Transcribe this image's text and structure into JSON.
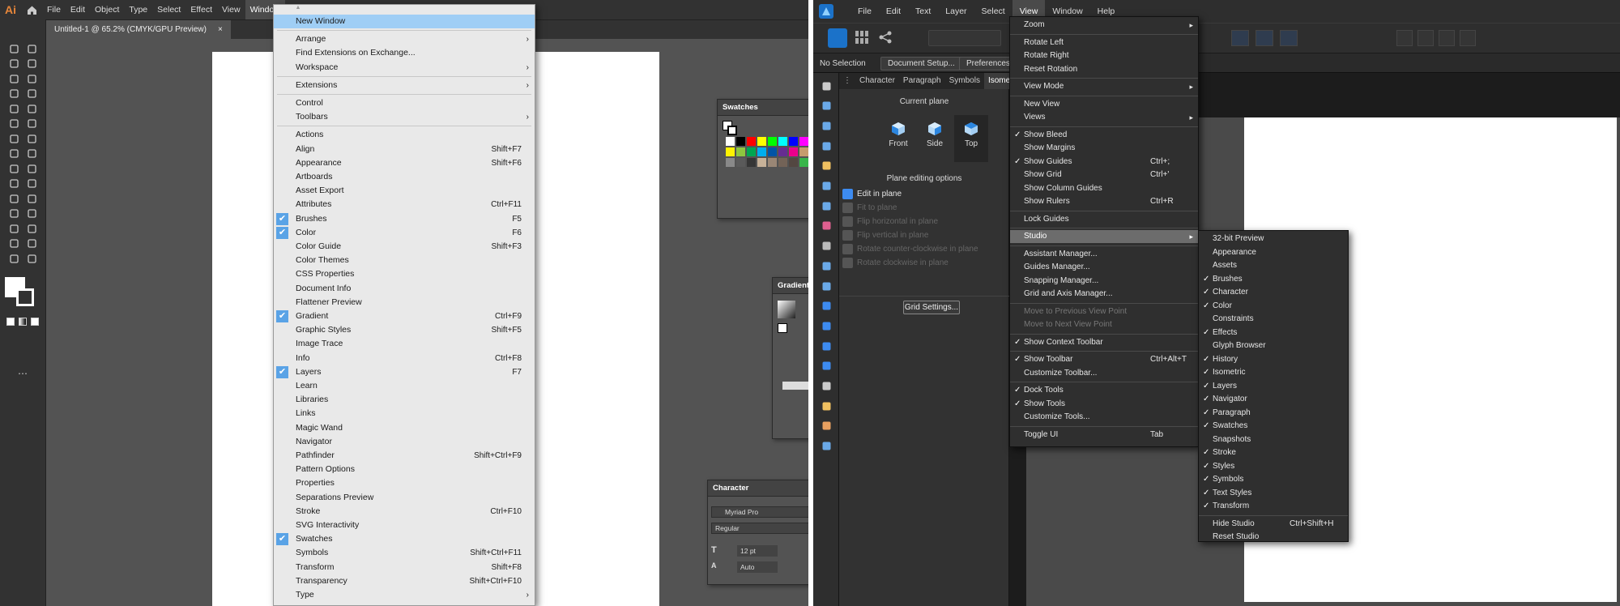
{
  "illustrator": {
    "logo": "Ai",
    "menubar": [
      "File",
      "Edit",
      "Object",
      "Type",
      "Select",
      "Effect",
      "View",
      "Window"
    ],
    "active_menu": "Window",
    "doc_tab": {
      "title": "Untitled-1 @ 65.2% (CMYK/GPU Preview)",
      "close": "×"
    },
    "window_menu": {
      "scroll_up": "▲",
      "items": [
        {
          "label": "New Window",
          "shortcut": "",
          "submenu": false,
          "checked": false,
          "highlight": true
        },
        {
          "sep": true
        },
        {
          "label": "Arrange",
          "shortcut": "",
          "submenu": true,
          "checked": false
        },
        {
          "label": "Find Extensions on Exchange...",
          "shortcut": "",
          "submenu": false,
          "checked": false
        },
        {
          "label": "Workspace",
          "shortcut": "",
          "submenu": true,
          "checked": false
        },
        {
          "sep": true
        },
        {
          "label": "Extensions",
          "shortcut": "",
          "submenu": true,
          "checked": false
        },
        {
          "sep": true
        },
        {
          "label": "Control",
          "shortcut": "",
          "submenu": false,
          "checked": false
        },
        {
          "label": "Toolbars",
          "shortcut": "",
          "submenu": true,
          "checked": false
        },
        {
          "sep": true
        },
        {
          "label": "Actions",
          "shortcut": "",
          "submenu": false,
          "checked": false
        },
        {
          "label": "Align",
          "shortcut": "Shift+F7",
          "submenu": false,
          "checked": false
        },
        {
          "label": "Appearance",
          "shortcut": "Shift+F6",
          "submenu": false,
          "checked": false
        },
        {
          "label": "Artboards",
          "shortcut": "",
          "submenu": false,
          "checked": false
        },
        {
          "label": "Asset Export",
          "shortcut": "",
          "submenu": false,
          "checked": false
        },
        {
          "label": "Attributes",
          "shortcut": "Ctrl+F11",
          "submenu": false,
          "checked": false
        },
        {
          "label": "Brushes",
          "shortcut": "F5",
          "submenu": false,
          "checked": true
        },
        {
          "label": "Color",
          "shortcut": "F6",
          "submenu": false,
          "checked": true
        },
        {
          "label": "Color Guide",
          "shortcut": "Shift+F3",
          "submenu": false,
          "checked": false
        },
        {
          "label": "Color Themes",
          "shortcut": "",
          "submenu": false,
          "checked": false
        },
        {
          "label": "CSS Properties",
          "shortcut": "",
          "submenu": false,
          "checked": false
        },
        {
          "label": "Document Info",
          "shortcut": "",
          "submenu": false,
          "checked": false
        },
        {
          "label": "Flattener Preview",
          "shortcut": "",
          "submenu": false,
          "checked": false
        },
        {
          "label": "Gradient",
          "shortcut": "Ctrl+F9",
          "submenu": false,
          "checked": true
        },
        {
          "label": "Graphic Styles",
          "shortcut": "Shift+F5",
          "submenu": false,
          "checked": false
        },
        {
          "label": "Image Trace",
          "shortcut": "",
          "submenu": false,
          "checked": false
        },
        {
          "label": "Info",
          "shortcut": "Ctrl+F8",
          "submenu": false,
          "checked": false
        },
        {
          "label": "Layers",
          "shortcut": "F7",
          "submenu": false,
          "checked": true
        },
        {
          "label": "Learn",
          "shortcut": "",
          "submenu": false,
          "checked": false
        },
        {
          "label": "Libraries",
          "shortcut": "",
          "submenu": false,
          "checked": false
        },
        {
          "label": "Links",
          "shortcut": "",
          "submenu": false,
          "checked": false
        },
        {
          "label": "Magic Wand",
          "shortcut": "",
          "submenu": false,
          "checked": false
        },
        {
          "label": "Navigator",
          "shortcut": "",
          "submenu": false,
          "checked": false
        },
        {
          "label": "Pathfinder",
          "shortcut": "Shift+Ctrl+F9",
          "submenu": false,
          "checked": false
        },
        {
          "label": "Pattern Options",
          "shortcut": "",
          "submenu": false,
          "checked": false
        },
        {
          "label": "Properties",
          "shortcut": "",
          "submenu": false,
          "checked": false
        },
        {
          "label": "Separations Preview",
          "shortcut": "",
          "submenu": false,
          "checked": false
        },
        {
          "label": "Stroke",
          "shortcut": "Ctrl+F10",
          "submenu": false,
          "checked": false
        },
        {
          "label": "SVG Interactivity",
          "shortcut": "",
          "submenu": false,
          "checked": false
        },
        {
          "label": "Swatches",
          "shortcut": "",
          "submenu": false,
          "checked": true
        },
        {
          "label": "Symbols",
          "shortcut": "Shift+Ctrl+F11",
          "submenu": false,
          "checked": false
        },
        {
          "label": "Transform",
          "shortcut": "Shift+F8",
          "submenu": false,
          "checked": false
        },
        {
          "label": "Transparency",
          "shortcut": "Shift+Ctrl+F10",
          "submenu": false,
          "checked": false
        },
        {
          "label": "Type",
          "shortcut": "",
          "submenu": true,
          "checked": false
        }
      ]
    },
    "panels": {
      "swatches": {
        "title": "Swatches"
      },
      "gradient": {
        "title": "Gradient"
      },
      "character": {
        "title": "Character",
        "font": "Myriad Pro",
        "style": "Regular",
        "size": "12 pt",
        "leading": "Auto"
      }
    },
    "swatch_colors": [
      "#ffffff",
      "#000000",
      "#ff0000",
      "#ffff00",
      "#00ff00",
      "#00ffff",
      "#0000ff",
      "#ff00ff",
      "#ed1c24",
      "#f7941d",
      "#fff200",
      "#8dc63f",
      "#00a651",
      "#00aeef",
      "#0054a6",
      "#662d91",
      "#ec008c",
      "#c69c6d",
      "#754c24",
      "#a0a0a0",
      "#898989",
      "#5a5a5a",
      "#363636",
      "#c7b299",
      "#998675",
      "#736357",
      "#534741",
      "#39b54a",
      "#2e3192",
      "#92278f"
    ]
  },
  "affinity": {
    "menubar": [
      "File",
      "Edit",
      "Text",
      "Layer",
      "Select",
      "View",
      "Window",
      "Help"
    ],
    "active_menu": "View",
    "context": {
      "selection": "No Selection",
      "doc_setup": "Document Setup...",
      "prefs": "Preferences..."
    },
    "studio_tabs": [
      "Character",
      "Paragraph",
      "Symbols",
      "Isometric"
    ],
    "active_tab": "Isometric",
    "isometric": {
      "current_plane": "Current plane",
      "planes": [
        "Front",
        "Side",
        "Top"
      ],
      "active_plane": "Top",
      "plane_editing": "Plane editing options",
      "options": [
        {
          "label": "Edit in plane",
          "enabled": true
        },
        {
          "label": "Fit to plane",
          "enabled": false
        },
        {
          "label": "Flip horizontal in plane",
          "enabled": false
        },
        {
          "label": "Flip vertical in plane",
          "enabled": false
        },
        {
          "label": "Rotate counter-clockwise in plane",
          "enabled": false
        },
        {
          "label": "Rotate clockwise in plane",
          "enabled": false
        }
      ],
      "grid_settings": "Grid Settings..."
    },
    "view_menu": {
      "items": [
        {
          "label": "Zoom",
          "submenu": true
        },
        {
          "sep": true
        },
        {
          "label": "Rotate Left"
        },
        {
          "label": "Rotate Right"
        },
        {
          "label": "Reset Rotation"
        },
        {
          "sep": true
        },
        {
          "label": "View Mode",
          "submenu": true
        },
        {
          "sep": true
        },
        {
          "label": "New View"
        },
        {
          "label": "Views",
          "submenu": true
        },
        {
          "sep": true
        },
        {
          "label": "Show Bleed",
          "checked": true
        },
        {
          "label": "Show Margins"
        },
        {
          "label": "Show Guides",
          "checked": true,
          "shortcut": "Ctrl+;"
        },
        {
          "label": "Show Grid",
          "shortcut": "Ctrl+'"
        },
        {
          "label": "Show Column Guides"
        },
        {
          "label": "Show Rulers",
          "shortcut": "Ctrl+R"
        },
        {
          "sep": true
        },
        {
          "label": "Lock Guides"
        },
        {
          "sep": true
        },
        {
          "label": "Studio",
          "submenu": true,
          "highlight": true
        },
        {
          "sep": true
        },
        {
          "label": "Assistant Manager..."
        },
        {
          "label": "Guides Manager..."
        },
        {
          "label": "Snapping Manager..."
        },
        {
          "label": "Grid and Axis Manager..."
        },
        {
          "sep": true
        },
        {
          "label": "Move to Previous View Point",
          "disabled": true
        },
        {
          "label": "Move to Next View Point",
          "disabled": true
        },
        {
          "sep": true
        },
        {
          "label": "Show Context Toolbar",
          "checked": true
        },
        {
          "sep": true
        },
        {
          "label": "Show Toolbar",
          "checked": true,
          "shortcut": "Ctrl+Alt+T"
        },
        {
          "label": "Customize Toolbar..."
        },
        {
          "sep": true
        },
        {
          "label": "Dock Tools",
          "checked": true
        },
        {
          "label": "Show Tools",
          "checked": true
        },
        {
          "label": "Customize Tools..."
        },
        {
          "sep": true
        },
        {
          "label": "Toggle UI",
          "shortcut": "Tab"
        }
      ]
    },
    "studio_menu": {
      "items": [
        {
          "label": "32-bit Preview"
        },
        {
          "label": "Appearance"
        },
        {
          "label": "Assets"
        },
        {
          "label": "Brushes",
          "checked": true
        },
        {
          "label": "Character",
          "checked": true
        },
        {
          "label": "Color",
          "checked": true
        },
        {
          "label": "Constraints"
        },
        {
          "label": "Effects",
          "checked": true
        },
        {
          "label": "Glyph Browser"
        },
        {
          "label": "History",
          "checked": true
        },
        {
          "label": "Isometric",
          "checked": true
        },
        {
          "label": "Layers",
          "checked": true
        },
        {
          "label": "Navigator",
          "checked": true
        },
        {
          "label": "Paragraph",
          "checked": true
        },
        {
          "label": "Swatches",
          "checked": true
        },
        {
          "label": "Snapshots"
        },
        {
          "label": "Stroke",
          "checked": true
        },
        {
          "label": "Styles",
          "checked": true
        },
        {
          "label": "Symbols",
          "checked": true
        },
        {
          "label": "Text Styles",
          "checked": true
        },
        {
          "label": "Transform",
          "checked": true
        },
        {
          "sep": true
        },
        {
          "label": "Hide Studio",
          "shortcut": "Ctrl+Shift+H"
        },
        {
          "label": "Reset Studio"
        }
      ]
    }
  }
}
